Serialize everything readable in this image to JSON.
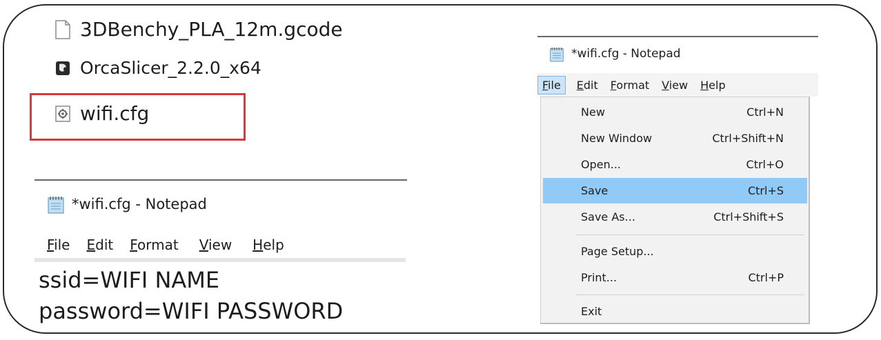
{
  "files": [
    {
      "name": "3DBenchy_PLA_12m.gcode",
      "icon": "document-icon"
    },
    {
      "name": "OrcaSlicer_2.2.0_x64",
      "icon": "orcaslicer-app-icon"
    },
    {
      "name": "wifi.cfg",
      "icon": "config-file-icon"
    }
  ],
  "left_notepad": {
    "title": "*wifi.cfg - Notepad",
    "menu": [
      "File",
      "Edit",
      "Format",
      "View",
      "Help"
    ],
    "content": [
      "ssid=WIFI NAME",
      "password=WIFI PASSWORD"
    ]
  },
  "right_notepad": {
    "title": "*wifi.cfg - Notepad",
    "menu": [
      "File",
      "Edit",
      "Format",
      "View",
      "Help"
    ],
    "file_menu": [
      {
        "label": "New",
        "shortcut": "Ctrl+N"
      },
      {
        "label": "New Window",
        "shortcut": "Ctrl+Shift+N"
      },
      {
        "label": "Open...",
        "shortcut": "Ctrl+O"
      },
      {
        "label": "Save",
        "shortcut": "Ctrl+S"
      },
      {
        "label": "Save As...",
        "shortcut": "Ctrl+Shift+S"
      },
      {
        "label": "Page Setup...",
        "shortcut": ""
      },
      {
        "label": "Print...",
        "shortcut": "Ctrl+P"
      },
      {
        "label": "Exit",
        "shortcut": ""
      }
    ],
    "selected_item": "Save"
  },
  "colors": {
    "highlight_border": "#d9383a",
    "menu_selected": "#91c9f7"
  }
}
